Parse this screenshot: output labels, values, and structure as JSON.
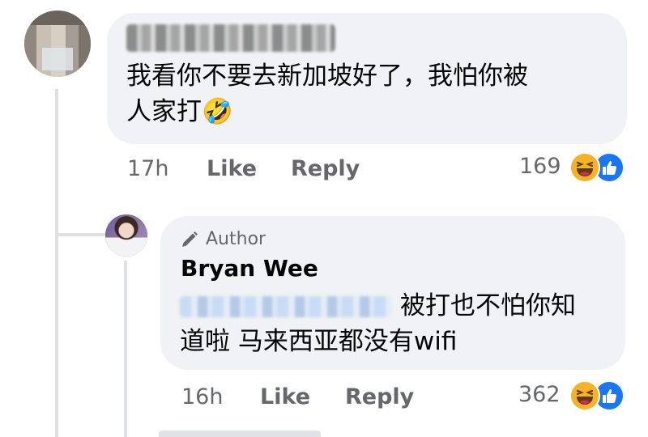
{
  "comments": [
    {
      "text_line1": "我看你不要去新加坡好了，我怕你被",
      "text_line2": "人家打🤣",
      "time": "17h",
      "like_label": "Like",
      "reply_label": "Reply",
      "reaction_count": "169",
      "reactions": [
        "haha-icon",
        "like-icon"
      ]
    },
    {
      "badge_label": "Author",
      "author": "Bryan Wee",
      "text_line1": "被打也不怕你知",
      "text_line2": "道啦 马来西亚都没有wifi",
      "time": "16h",
      "like_label": "Like",
      "reply_label": "Reply",
      "reaction_count": "362",
      "reactions": [
        "haha-icon",
        "like-icon"
      ]
    }
  ],
  "colors": {
    "bubble": "#f0f2f5",
    "meta_text": "#65676b",
    "like_blue": "#1877f2",
    "haha_yellow": "#f7b125"
  }
}
